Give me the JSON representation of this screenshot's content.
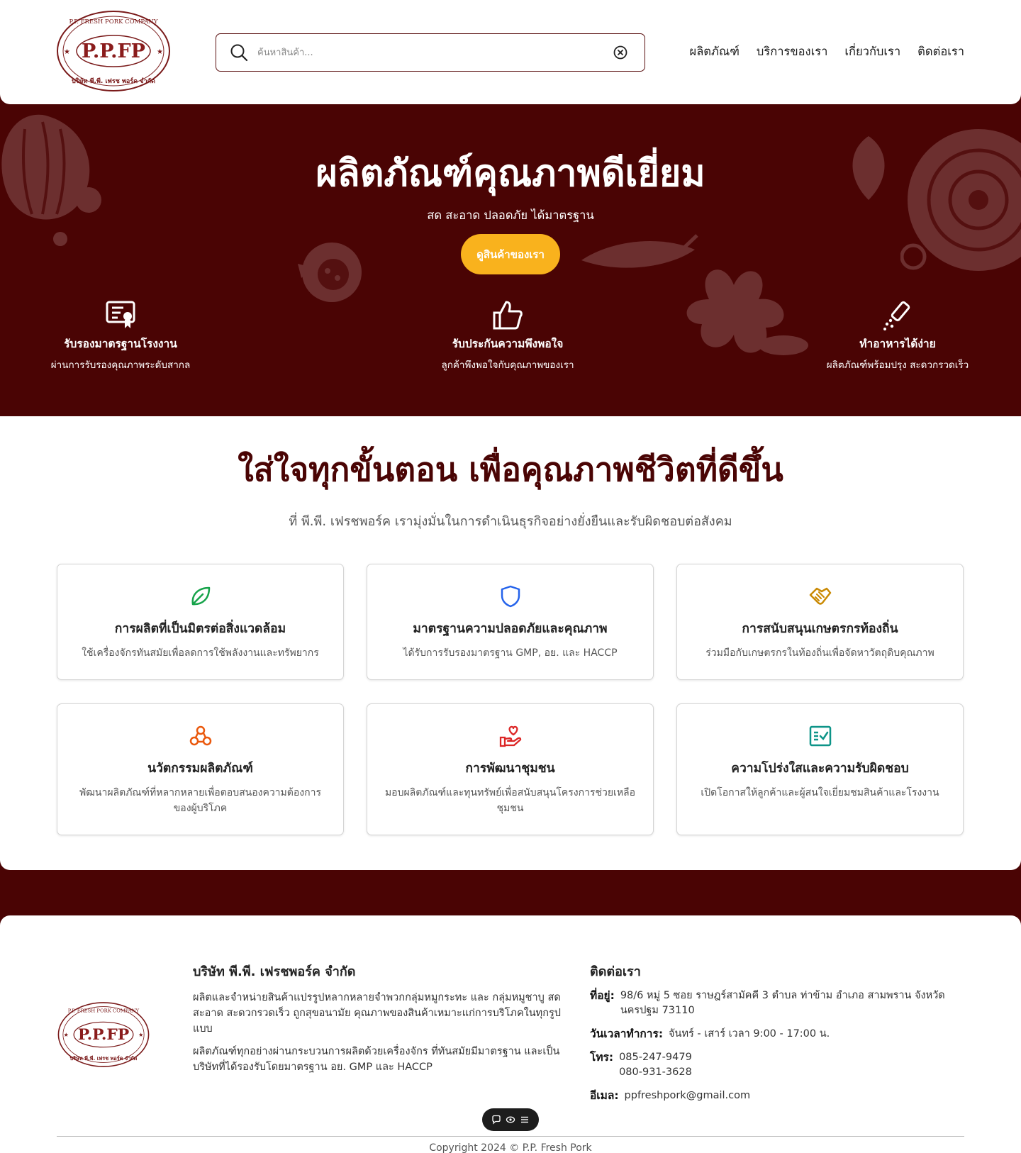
{
  "header": {
    "logo_text": "P.P.FP",
    "logo_ring_top": "P.P. FRESH PORK COMPANY",
    "logo_ring_bottom": "บริษัท พี.พี. เฟรช พอร์ค จำกัด",
    "search_placeholder": "ค้นหาสินค้า...",
    "nav": [
      "ผลิตภัณฑ์",
      "บริการของเรา",
      "เกี่ยวกับเรา",
      "ติดต่อเรา"
    ]
  },
  "hero": {
    "title": "ผลิตภัณฑ์คุณภาพดีเยี่ยม",
    "subtitle": "สด สะอาด ปลอดภัย ได้มาตรฐาน",
    "cta": "ดูสินค้าของเรา",
    "features": [
      {
        "icon": "certificate-icon",
        "title": "รับรองมาตรฐานโรงงาน",
        "desc": "ผ่านการรับรองคุณภาพระดับสากล"
      },
      {
        "icon": "thumbs-up-icon",
        "title": "รับประกันความพึงพอใจ",
        "desc": "ลูกค้าพึงพอใจกับคุณภาพของเรา"
      },
      {
        "icon": "seasoning-icon",
        "title": "ทำอาหารได้ง่าย",
        "desc": "ผลิตภัณฑ์พร้อมปรุง สะดวกรวดเร็ว"
      }
    ]
  },
  "commitment": {
    "title": "ใส่ใจทุกขั้นตอน เพื่อคุณภาพชีวิตที่ดีขึ้น",
    "subtitle": "ที่ พี.พี. เฟรชพอร์ค เรามุ่งมั่นในการดำเนินธุรกิจอย่างยั่งยืนและรับผิดชอบต่อสังคม",
    "cards": [
      {
        "icon": "leaf-icon",
        "color": "#16a34a",
        "title": "การผลิตที่เป็นมิตรต่อสิ่งแวดล้อม",
        "desc": "ใช้เครื่องจักรทันสมัยเพื่อลดการใช้พลังงานและทรัพยากร"
      },
      {
        "icon": "shield-icon",
        "color": "#2563eb",
        "title": "มาตรฐานความปลอดภัยและคุณภาพ",
        "desc": "ได้รับการรับรองมาตรฐาน GMP, อย. และ HACCP"
      },
      {
        "icon": "handshake-icon",
        "color": "#ca8a04",
        "title": "การสนับสนุนเกษตรกรท้องถิ่น",
        "desc": "ร่วมมือกับเกษตรกรในท้องถิ่นเพื่อจัดหาวัตถุดิบคุณภาพ"
      },
      {
        "icon": "innovation-icon",
        "color": "#ea580c",
        "title": "นวัตกรรมผลิตภัณฑ์",
        "desc": "พัฒนาผลิตภัณฑ์ที่หลากหลายเพื่อตอบสนองความต้องการของผู้บริโภค"
      },
      {
        "icon": "heart-hand-icon",
        "color": "#dc2626",
        "title": "การพัฒนาชุมชน",
        "desc": "มอบผลิตภัณฑ์และทุนทรัพย์เพื่อสนับสนุนโครงการช่วยเหลือชุมชน"
      },
      {
        "icon": "checklist-icon",
        "color": "#0d9488",
        "title": "ความโปร่งใสและความรับผิดชอบ",
        "desc": "เปิดโอกาสให้ลูกค้าและผู้สนใจเยี่ยมชมสินค้าและโรงงาน"
      }
    ]
  },
  "footer": {
    "company_title": "บริษัท พี.พี. เฟรชพอร์ค จำกัด",
    "company_desc_1": "ผลิตและจำหน่ายสินค้าแปรรูปหลากหลายจำพวกกลุ่มหมูกระทะ และ กลุ่มหมูชาบู สด สะอาด สะดวกรวดเร็ว ถูกสุขอนามัย คุณภาพของสินค้าเหมาะแก่การบริโภคในทุกรูปแบบ",
    "company_desc_2": "ผลิตภัณฑ์ทุกอย่างผ่านกระบวนการผลิตด้วยเครื่องจักร ที่ทันสมัยมีมาตรฐาน และเป็นบริษัทที่ได้รองรับโดยมาตรฐาน อย. GMP และ HACCP",
    "contact_title": "ติดต่อเรา",
    "address_label": "ที่อยู่:",
    "address": "98/6 หมู่ 5 ซอย ราษฎร์สามัคคี 3 ตำบล ท่าข้าม อำเภอ สามพราน จังหวัด นครปฐม 73110",
    "hours_label": "วันเวลาทำการ:",
    "hours": "จันทร์ - เสาร์ เวลา 9:00 - 17:00 น.",
    "phone_label": "โทร:",
    "phone_1": "085-247-9479",
    "phone_2": "080-931-3628",
    "email_label": "อีเมล:",
    "email": "ppfreshpork@gmail.com",
    "copyright": "Copyright 2024 © P.P. Fresh Pork"
  },
  "colors": {
    "brand": "#4a0404",
    "accent": "#f9b21d"
  }
}
